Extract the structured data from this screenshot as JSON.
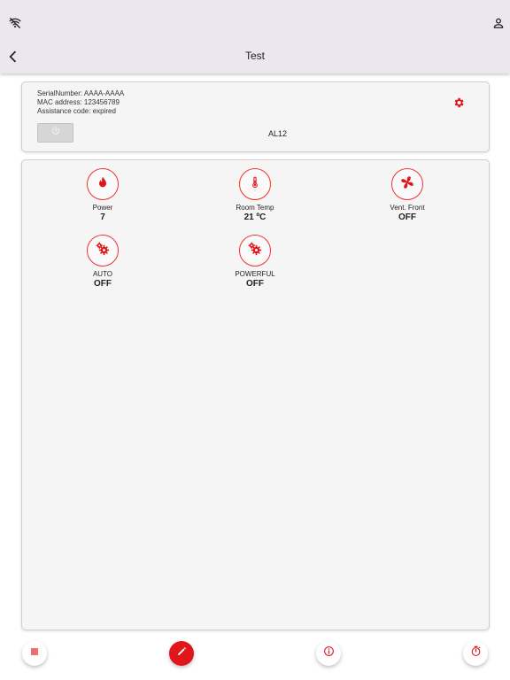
{
  "header": {
    "title": "Test",
    "icons": {
      "left": "wifi-off-icon",
      "right": "account-icon",
      "back": "chevron-left-icon"
    }
  },
  "device": {
    "serial_line": "SerialNumber: AAAA-AAAA",
    "mac_line": "MAC address: 123456789",
    "assistance_line": "Assistance code: expired",
    "model": "AL12",
    "settings_icon": "gear-icon",
    "power_icon": "power-icon"
  },
  "tiles": [
    {
      "label": "Power",
      "value": "7",
      "icon": "flame-icon"
    },
    {
      "label": "Room Temp",
      "value": "21 ºC",
      "icon": "thermometer-icon"
    },
    {
      "label": "Vent. Front",
      "value": "OFF",
      "icon": "fan-icon"
    },
    {
      "label": "AUTO",
      "value": "OFF",
      "icon": "gears-icon"
    },
    {
      "label": "POWERFUL",
      "value": "OFF",
      "icon": "gears-icon"
    }
  ],
  "bottom_bar": {
    "buttons": [
      "list-icon",
      "edit-icon",
      "info-icon",
      "timer-icon"
    ]
  },
  "colors": {
    "accent": "#e0161b",
    "appbar": "#ece6ee",
    "card": "#f5f5f5"
  }
}
